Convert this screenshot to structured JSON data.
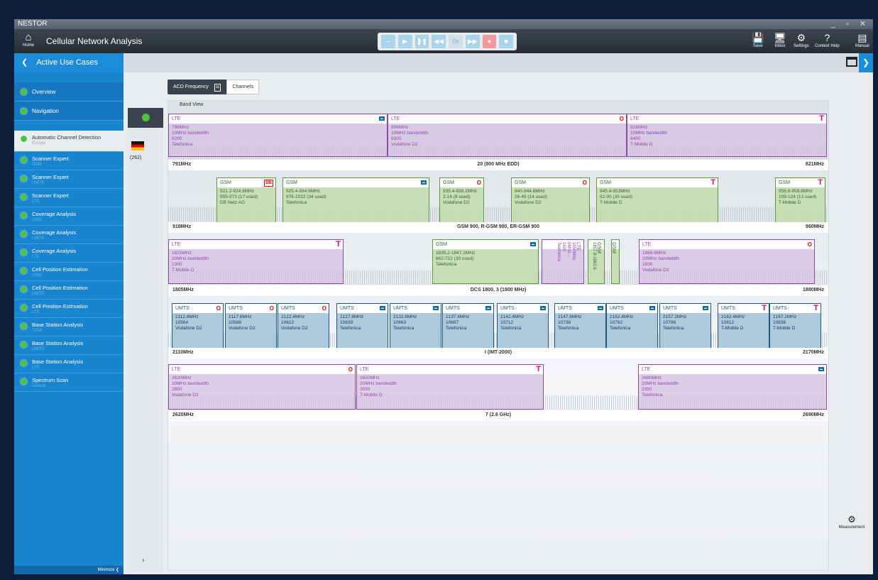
{
  "window": {
    "title": "NESTOR",
    "controls": "_ ▫ ✕"
  },
  "toolbar": {
    "home_label": "Home",
    "app_title": "Cellular Network Analysis",
    "player": [
      "⇔",
      "▶",
      "❚❚",
      "◀◀",
      "0x",
      "▶▶",
      "●",
      "■"
    ],
    "right": [
      {
        "label": "Save",
        "icon": "save-icon",
        "glyph": "💾"
      },
      {
        "label": "Inbox",
        "icon": "inbox-icon",
        "glyph": "🖥"
      },
      {
        "label": "Settings",
        "icon": "gear-icon",
        "glyph": "⚙"
      },
      {
        "label": "Context Help",
        "icon": "help-icon",
        "glyph": "?"
      },
      {
        "label": "Manual",
        "icon": "manual-icon",
        "glyph": "▤"
      }
    ]
  },
  "sidebar": {
    "header": "Active Use Cases",
    "minimize": "Minimize",
    "items": [
      {
        "label": "Overview",
        "sub": ""
      },
      {
        "label": "Navigation",
        "sub": ""
      },
      {
        "label": "Automatic Channel Detection",
        "sub": "Europe"
      },
      {
        "label": "Scanner Expert",
        "sub": "GSM"
      },
      {
        "label": "Scanner Expert",
        "sub": "UMTS"
      },
      {
        "label": "Scanner Expert",
        "sub": "LTE"
      },
      {
        "label": "Coverage Analysis",
        "sub": "GSM"
      },
      {
        "label": "Coverage Analysis",
        "sub": "UMTS"
      },
      {
        "label": "Coverage Analysis",
        "sub": "LTE"
      },
      {
        "label": "Cell Position Estimation",
        "sub": "GSM"
      },
      {
        "label": "Cell Position Estimation",
        "sub": "UMTS"
      },
      {
        "label": "Cell Position Estimation",
        "sub": "LTE"
      },
      {
        "label": "Base Station Analysis",
        "sub": "GSM"
      },
      {
        "label": "Base Station Analysis",
        "sub": "UMTS"
      },
      {
        "label": "Base Station Analysis",
        "sub": "LTE"
      },
      {
        "label": "Spectrum Scan",
        "sub": "Default"
      }
    ]
  },
  "country": {
    "count": "(262)",
    "chevron": "›"
  },
  "tabs": {
    "acd": "ACD Frequency",
    "channels": "Channels"
  },
  "bandview": {
    "title": "Band View"
  },
  "measurement": {
    "label": "Measurement"
  },
  "bands": [
    {
      "name": "20 (800 MHz EDD)",
      "low": "791MHz",
      "high": "821MHz"
    },
    {
      "name": "GSM 900, R-GSM 900, ER-GSM 900",
      "low": "918MHz",
      "high": "960MHz"
    },
    {
      "name": "DCS 1800, 3 (1800 MHz)",
      "low": "1805MHz",
      "high": "1880MHz"
    },
    {
      "name": "I (IMT-2000)",
      "low": "2110MHz",
      "high": "2170MHz"
    },
    {
      "name": "7 (2.6 GHz)",
      "low": "2620MHz",
      "high": "2690MHz"
    }
  ],
  "blocks": {
    "b0": [
      {
        "tech": "LTE",
        "lines": [
          "796MHz",
          "10MHz bandwidth",
          "6200",
          "Telefonica"
        ]
      },
      {
        "tech": "LTE",
        "lines": [
          "806MHz",
          "10MHz bandwidth",
          "6300",
          "Vodafone D2"
        ]
      },
      {
        "tech": "LTE",
        "lines": [
          "816MHz",
          "10MHz bandwidth",
          "6400",
          "T-Mobile D"
        ]
      }
    ],
    "b1": [
      {
        "tech": "GSM",
        "lines": [
          "921.2-924.8MHz",
          "955-973 (17 used)",
          "DB Netz AG"
        ]
      },
      {
        "tech": "GSM",
        "lines": [
          "925.4-934.6MHz",
          "976-1022 (34 used)",
          "Telefonica"
        ]
      },
      {
        "tech": "GSM",
        "lines": [
          "935.4-938.2MHz",
          "2-16 (8 used)",
          "Vodafone D2"
        ]
      },
      {
        "tech": "GSM",
        "lines": [
          "940-944.8MHz",
          "26-49 (14 used)",
          "Vodafone D2"
        ]
      },
      {
        "tech": "GSM",
        "lines": [
          "945.4-953MHz",
          "52-90 (35 used)",
          "T-Mobile D"
        ]
      },
      {
        "tech": "GSM",
        "lines": [
          "956.8-959.8MHz",
          "109-124 (13 used)",
          "T-Mobile D"
        ]
      }
    ],
    "b2": [
      {
        "tech": "LTE",
        "lines": [
          "1815MHz",
          "20MHz bandwidth",
          "1300",
          "T-Mobile D"
        ]
      },
      {
        "tech": "GSM",
        "lines": [
          "1835.2-1847.2MHz",
          "662-722 (30 used)",
          "Telefonica"
        ]
      },
      {
        "tech": "LTE",
        "lines": [
          "1850MHz",
          "5MHz...",
          "1600",
          "Telefonica"
        ]
      },
      {
        "tech": "GSM",
        "lines": [
          "1857.8-1862.6"
        ]
      },
      {
        "tech": "GSM",
        "lines": [
          ""
        ]
      },
      {
        "tech": "LTE",
        "lines": [
          "1868.6MHz",
          "20MHz bandwidth",
          "1836",
          "Vodafone D2"
        ]
      }
    ],
    "b3": [
      {
        "tech": "UMTS",
        "lines": [
          "2112.8MHz",
          "10564",
          "Vodafone D2"
        ]
      },
      {
        "tech": "UMTS",
        "lines": [
          "2117.6MHz",
          "10588",
          "Vodafone D2"
        ]
      },
      {
        "tech": "UMTS",
        "lines": [
          "2122.4MHz",
          "10612",
          "Vodafone D2"
        ]
      },
      {
        "tech": "UMTS",
        "lines": [
          "2127.8MHz",
          "10639",
          "Telefonica"
        ]
      },
      {
        "tech": "UMTS",
        "lines": [
          "2132.6MHz",
          "10663",
          "Telefonica"
        ]
      },
      {
        "tech": "UMTS",
        "lines": [
          "2137.4MHz",
          "10687",
          "Telefonica"
        ]
      },
      {
        "tech": "UMTS",
        "lines": [
          "2142.4MHz",
          "10712",
          "Telefonica"
        ]
      },
      {
        "tech": "UMTS",
        "lines": [
          "2147.6MHz",
          "10738",
          "Telefonica"
        ]
      },
      {
        "tech": "UMTS",
        "lines": [
          "2152.4MHz",
          "10762",
          "Telefonica"
        ]
      },
      {
        "tech": "UMTS",
        "lines": [
          "2157.2MHz",
          "10786",
          "Telefonica"
        ]
      },
      {
        "tech": "UMTS",
        "lines": [
          "2162.4MHz",
          "10812",
          "T-Mobile D"
        ]
      },
      {
        "tech": "UMTS",
        "lines": [
          "2167.2MHz",
          "10836",
          "T-Mobile D"
        ]
      }
    ],
    "b4": [
      {
        "tech": "LTE",
        "lines": [
          "2630MHz",
          "20MHz bandwidth",
          "2850",
          "Vodafone D2"
        ]
      },
      {
        "tech": "LTE",
        "lines": [
          "2650MHz",
          "20MHz bandwidth",
          "3050",
          "T-Mobile D"
        ]
      },
      {
        "tech": "LTE",
        "lines": [
          "2680MHz",
          "20MHz bandwidth",
          "3350",
          "Telefonica"
        ]
      }
    ]
  }
}
